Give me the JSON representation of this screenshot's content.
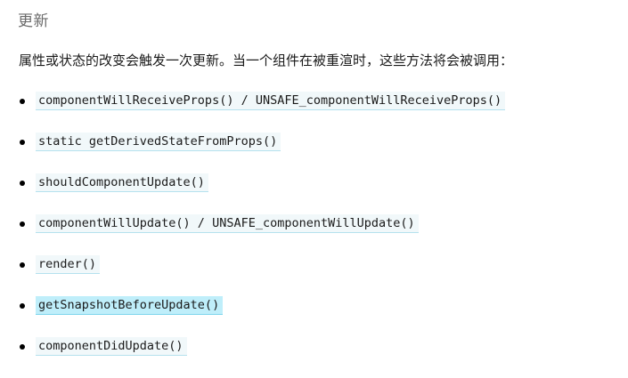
{
  "section": {
    "heading": "更新",
    "intro": "属性或状态的改变会触发一次更新。当一个组件在被重渲时，这些方法将会被调用："
  },
  "methods": [
    {
      "code": "componentWillReceiveProps() / UNSAFE_componentWillReceiveProps()",
      "highlighted": false
    },
    {
      "code": "static getDerivedStateFromProps()",
      "highlighted": false
    },
    {
      "code": "shouldComponentUpdate()",
      "highlighted": false
    },
    {
      "code": "componentWillUpdate() / UNSAFE_componentWillUpdate()",
      "highlighted": false
    },
    {
      "code": "render()",
      "highlighted": false
    },
    {
      "code": "getSnapshotBeforeUpdate()",
      "highlighted": true
    },
    {
      "code": "componentDidUpdate()",
      "highlighted": false
    }
  ],
  "colors": {
    "code_background": "#f1f8fa",
    "code_underline": "#b5e1ee",
    "highlight_background": "#bfeefa",
    "heading_text": "#6b6b6b"
  }
}
